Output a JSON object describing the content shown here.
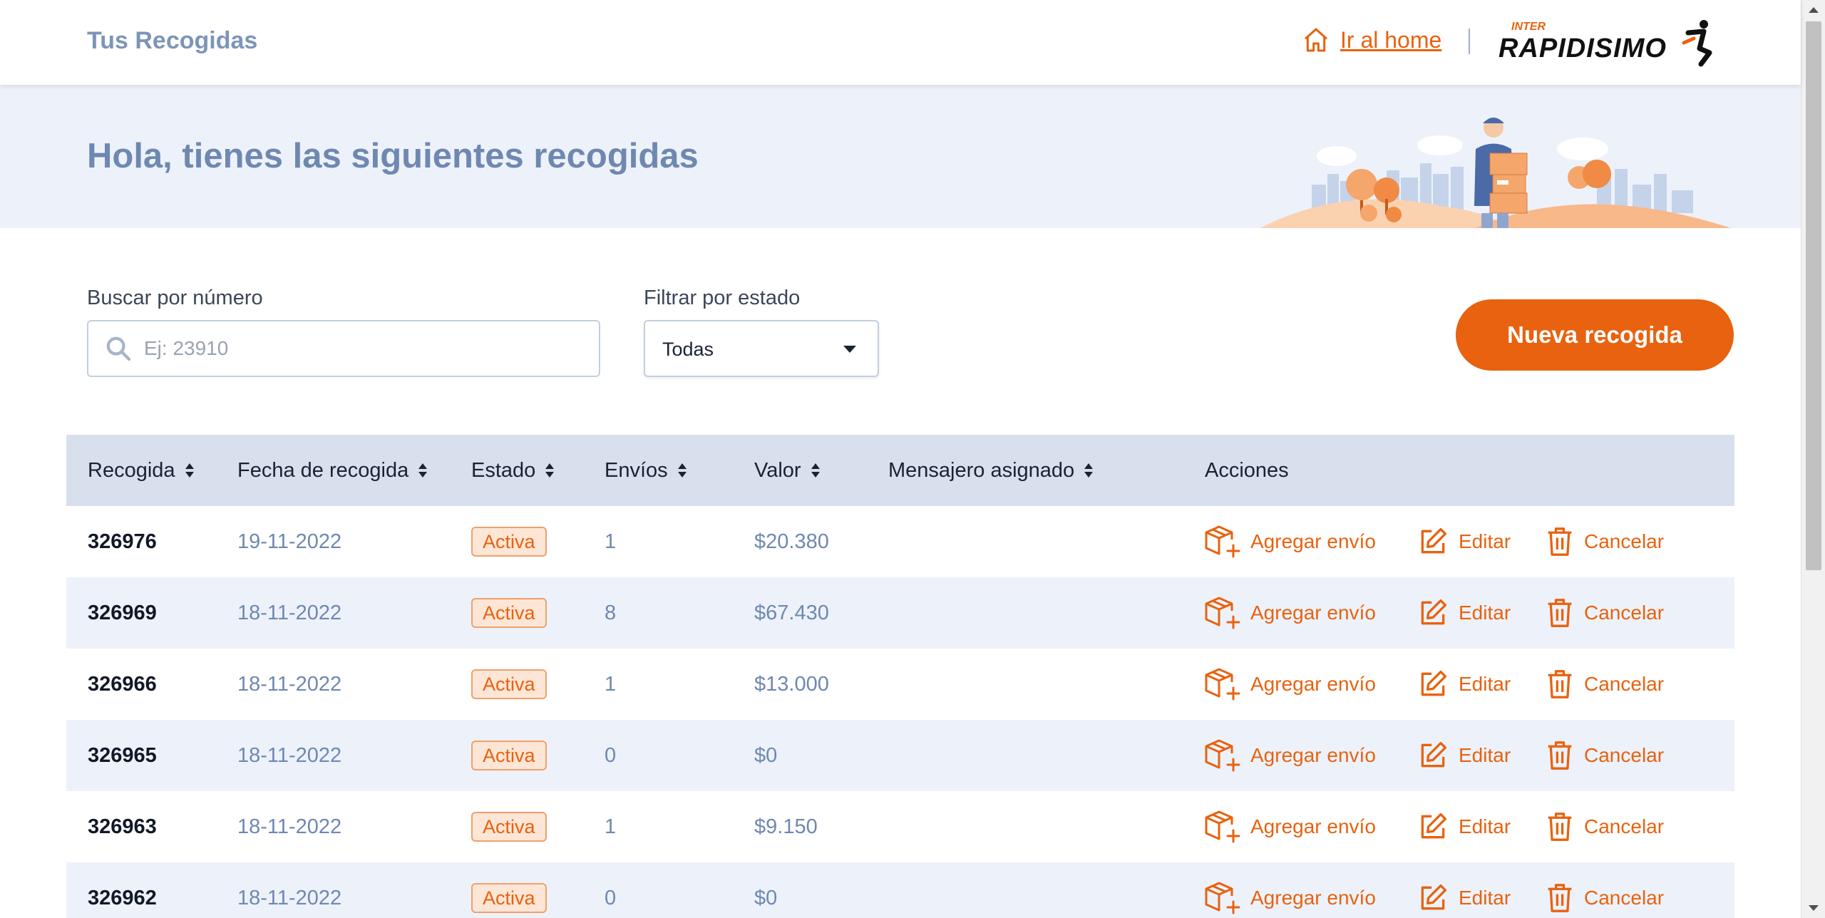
{
  "header": {
    "title": "Tus Recogidas",
    "home_link": "Ir al home",
    "logo_small": "INTER",
    "logo_main": "RAPIDISIMO"
  },
  "banner": {
    "greeting": "Hola, tienes las siguientes recogidas"
  },
  "filters": {
    "search_label": "Buscar por número",
    "search_placeholder": "Ej: 23910",
    "search_value": "",
    "status_label": "Filtrar por estado",
    "status_selected": "Todas"
  },
  "new_button": "Nueva recogida",
  "table": {
    "columns": [
      "Recogida",
      "Fecha de recogida",
      "Estado",
      "Envíos",
      "Valor",
      "Mensajero asignado",
      "Acciones"
    ],
    "actions": {
      "add": "Agregar envío",
      "edit": "Editar",
      "cancel": "Cancelar"
    },
    "rows": [
      {
        "id": "326976",
        "date": "19-11-2022",
        "status": "Activa",
        "count": "1",
        "value": "$20.380",
        "courier": ""
      },
      {
        "id": "326969",
        "date": "18-11-2022",
        "status": "Activa",
        "count": "8",
        "value": "$67.430",
        "courier": ""
      },
      {
        "id": "326966",
        "date": "18-11-2022",
        "status": "Activa",
        "count": "1",
        "value": "$13.000",
        "courier": ""
      },
      {
        "id": "326965",
        "date": "18-11-2022",
        "status": "Activa",
        "count": "0",
        "value": "$0",
        "courier": ""
      },
      {
        "id": "326963",
        "date": "18-11-2022",
        "status": "Activa",
        "count": "1",
        "value": "$9.150",
        "courier": ""
      },
      {
        "id": "326962",
        "date": "18-11-2022",
        "status": "Activa",
        "count": "0",
        "value": "$0",
        "courier": ""
      }
    ]
  },
  "colors": {
    "accent": "#e8620f",
    "title_blue": "#6f88b0",
    "header_row": "#d8e0ee",
    "alt_row": "#edf2fa"
  },
  "icons": [
    "home-icon",
    "search-icon",
    "chevron-down-icon",
    "box-add-icon",
    "edit-icon",
    "trash-icon",
    "sort-icon"
  ]
}
